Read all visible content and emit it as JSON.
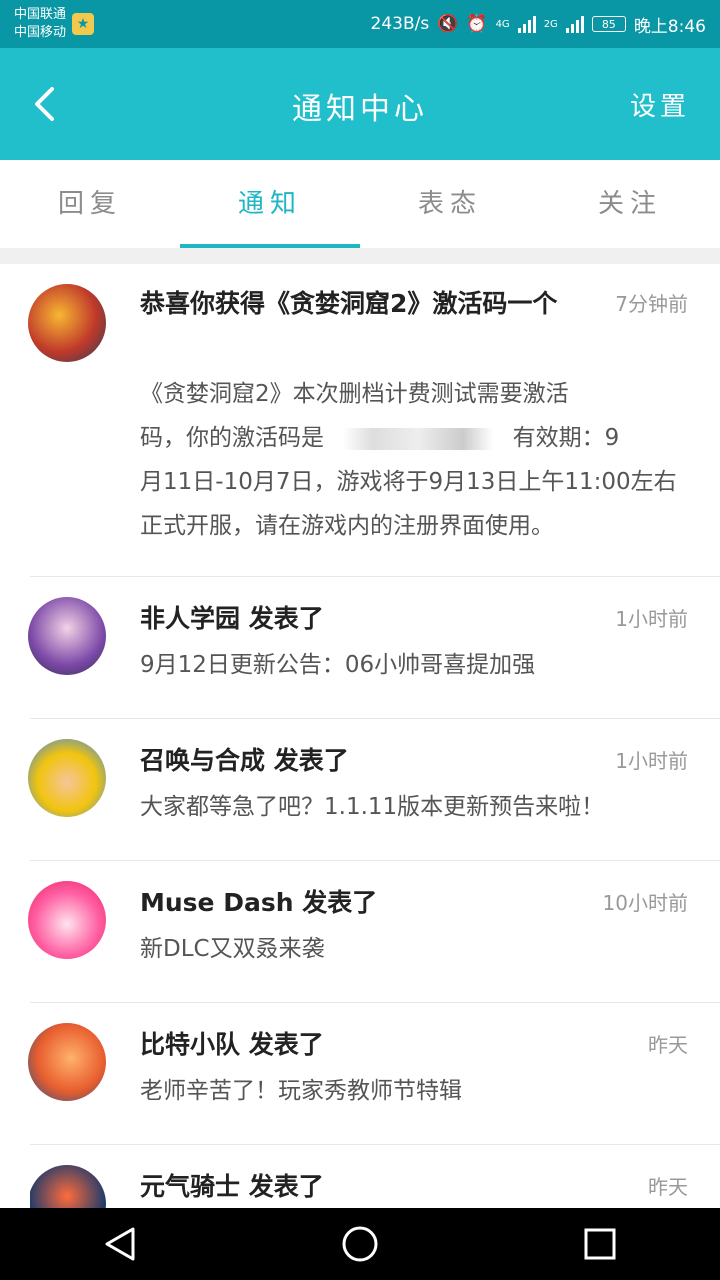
{
  "status_bar": {
    "carrier1": "中国联通",
    "carrier2": "中国移动",
    "net_speed": "243B/s",
    "net1": "4G",
    "net2": "2G",
    "battery": "85",
    "time": "晚上8:46"
  },
  "header": {
    "title": "通知中心",
    "settings_label": "设置"
  },
  "tabs": [
    {
      "label": "回复"
    },
    {
      "label": "通知"
    },
    {
      "label": "表态"
    },
    {
      "label": "关注"
    }
  ],
  "notifications": [
    {
      "title": "恭喜你获得《贪婪洞窟2》激活码一个",
      "time": "7分钟前",
      "desc_line1": "《贪婪洞窟2》本次删档计费测试需要激活",
      "desc_line2_a": "码，你的激活码是",
      "desc_line2_b": "有效期：9",
      "desc_line3": "月11日-10月7日，游戏将于9月13日上午11:00左右",
      "desc_line4": "正式开服，请在游戏内的注册界面使用。"
    },
    {
      "title": "非人学园 发表了",
      "time": "1小时前",
      "desc": "9月12日更新公告：06小帅哥喜提加强"
    },
    {
      "title": "召唤与合成 发表了",
      "time": "1小时前",
      "desc": "大家都等急了吧？1.1.11版本更新预告来啦！"
    },
    {
      "title": "Muse Dash 发表了",
      "time": "10小时前",
      "desc": "新DLC又双叒来袭"
    },
    {
      "title": "比特小队 发表了",
      "time": "昨天",
      "desc": "老师辛苦了！玩家秀教师节特辑"
    },
    {
      "title": "元气骑士 发表了",
      "time": "昨天",
      "desc": ""
    }
  ],
  "colors": {
    "header_bg": "#20bfcb",
    "status_bg": "#0a97a5",
    "accent": "#1fb6c4"
  }
}
